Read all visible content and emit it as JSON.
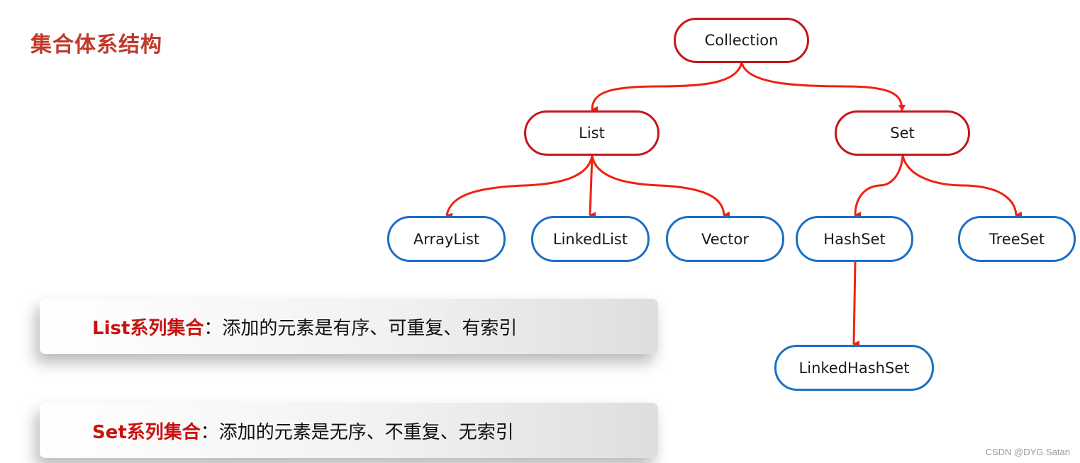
{
  "title": "集合体系结构",
  "colors": {
    "title": "#c0392b",
    "interface_border": "#c4161c",
    "impl_border": "#1a6fc4",
    "arrow": "#ee2211",
    "highlight_text": "#c8120f"
  },
  "tree": {
    "nodes": {
      "collection": "Collection",
      "list": "List",
      "set": "Set",
      "arraylist": "ArrayList",
      "linkedlist": "LinkedList",
      "vector": "Vector",
      "hashset": "HashSet",
      "treeset": "TreeSet",
      "linkedhashset": "LinkedHashSet"
    },
    "edges": [
      [
        "Collection",
        "List"
      ],
      [
        "Collection",
        "Set"
      ],
      [
        "List",
        "ArrayList"
      ],
      [
        "List",
        "LinkedList"
      ],
      [
        "List",
        "Vector"
      ],
      [
        "Set",
        "HashSet"
      ],
      [
        "Set",
        "TreeSet"
      ],
      [
        "HashSet",
        "LinkedHashSet"
      ]
    ]
  },
  "cards": [
    {
      "highlight": "List系列集合",
      "text": "：添加的元素是有序、可重复、有索引"
    },
    {
      "highlight": "Set系列集合",
      "text": "：添加的元素是无序、不重复、无索引"
    }
  ],
  "watermark": "CSDN @DYG.Satan"
}
